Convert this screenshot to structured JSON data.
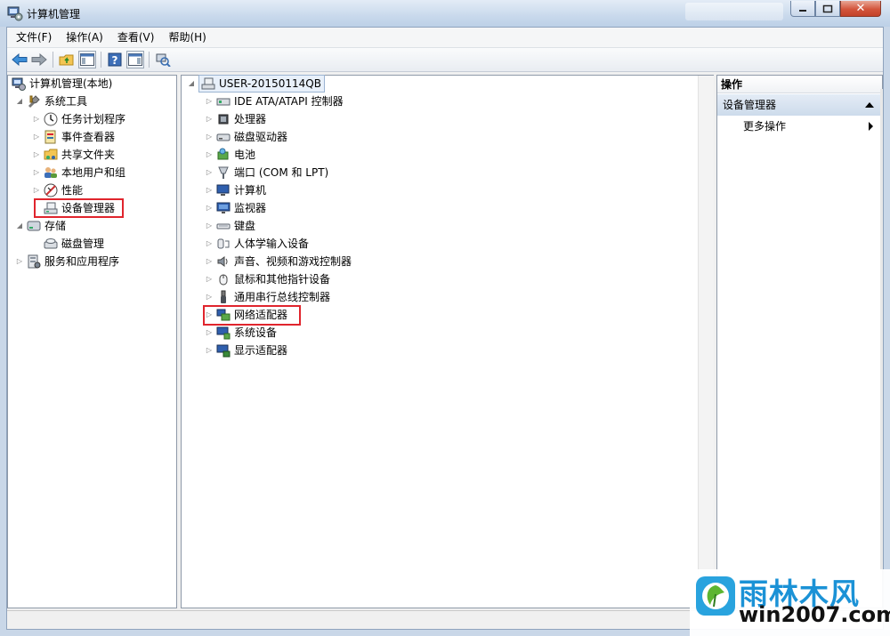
{
  "window": {
    "title": "计算机管理"
  },
  "menu": [
    {
      "label": "文件(F)"
    },
    {
      "label": "操作(A)"
    },
    {
      "label": "查看(V)"
    },
    {
      "label": "帮助(H)"
    }
  ],
  "toolbar": {
    "buttons": [
      "back-arrow-icon",
      "forward-arrow-icon",
      "up-folder-icon",
      "show-hide-tree-icon",
      "help-icon",
      "show-hide-action-pane-icon",
      "scan-hardware-icon"
    ]
  },
  "left_tree": {
    "root": "计算机管理(本地)",
    "system_tools": "系统工具",
    "task_scheduler": "任务计划程序",
    "event_viewer": "事件查看器",
    "shared_folders": "共享文件夹",
    "local_users": "本地用户和组",
    "performance": "性能",
    "device_manager": "设备管理器",
    "storage": "存储",
    "disk_management": "磁盘管理",
    "services": "服务和应用程序"
  },
  "device_tree": {
    "computer_name": "USER-20150114QB",
    "categories": [
      {
        "label": "IDE ATA/ATAPI 控制器",
        "icon": "ide-controller-icon"
      },
      {
        "label": "处理器",
        "icon": "processor-icon"
      },
      {
        "label": "磁盘驱动器",
        "icon": "disk-drive-icon"
      },
      {
        "label": "电池",
        "icon": "battery-icon"
      },
      {
        "label": "端口 (COM 和 LPT)",
        "icon": "port-icon"
      },
      {
        "label": "计算机",
        "icon": "computer-icon"
      },
      {
        "label": "监视器",
        "icon": "monitor-icon"
      },
      {
        "label": "键盘",
        "icon": "keyboard-icon"
      },
      {
        "label": "人体学输入设备",
        "icon": "hid-icon"
      },
      {
        "label": "声音、视频和游戏控制器",
        "icon": "sound-icon"
      },
      {
        "label": "鼠标和其他指针设备",
        "icon": "mouse-icon"
      },
      {
        "label": "通用串行总线控制器",
        "icon": "usb-icon"
      },
      {
        "label": "网络适配器",
        "icon": "network-adapter-icon"
      },
      {
        "label": "系统设备",
        "icon": "system-device-icon"
      },
      {
        "label": "显示适配器",
        "icon": "display-adapter-icon"
      }
    ]
  },
  "actions_pane": {
    "header": "操作",
    "section": "设备管理器",
    "more": "更多操作"
  },
  "watermark": {
    "brand": "雨林木风",
    "url": "win2007.com"
  },
  "colors": {
    "highlight": "#e0252d",
    "brand": "#1b92d6"
  }
}
